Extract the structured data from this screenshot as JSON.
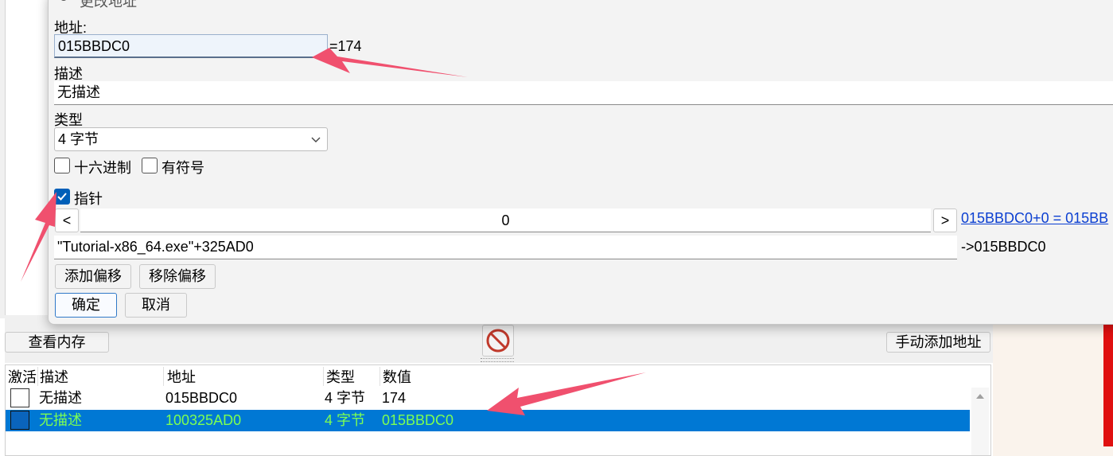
{
  "dialog": {
    "title": "更改地址",
    "address_label": "地址:",
    "address_value": "015BBDC0",
    "address_result": "=174",
    "description_label": "描述",
    "description_value": "无描述",
    "type_label": "类型",
    "type_selected": "4 字节",
    "hex_label": "十六进制",
    "signed_label": "有符号",
    "pointer_label": "指针",
    "offset_prev": "<",
    "offset_value": "0",
    "offset_next": ">",
    "offset_result_link": "015BBDC0+0 = 015BB",
    "base_address_value": "\"Tutorial-x86_64.exe\"+325AD0",
    "base_address_result": "->015BBDC0",
    "add_offset_button": "添加偏移",
    "remove_offset_button": "移除偏移",
    "ok_button": "确定",
    "cancel_button": "取消"
  },
  "main": {
    "memory_view_button": "查看内存",
    "add_address_manually_button": "手动添加地址",
    "columns": [
      "激活",
      "描述",
      "地址",
      "类型",
      "数值"
    ],
    "rows": [
      {
        "description": "无描述",
        "address": "015BBDC0",
        "type": "4 字节",
        "value": "174",
        "selected": false
      },
      {
        "description": "无描述",
        "address": "100325AD0",
        "type": "4 字节",
        "value": "015BBDC0",
        "selected": true
      }
    ]
  },
  "colors": {
    "selection": "#0078d4",
    "selected_text": "#7dff52",
    "annotation_arrow": "#f0506e",
    "link": "#0b3fd1",
    "checkbox_checked": "#005fb8"
  },
  "icons": {
    "title": "gear-icon",
    "stop": "no-entry-icon",
    "dropdown": "chevron-down-icon",
    "checkmark": "check-icon",
    "scroll_up": "triangle-up-icon"
  }
}
